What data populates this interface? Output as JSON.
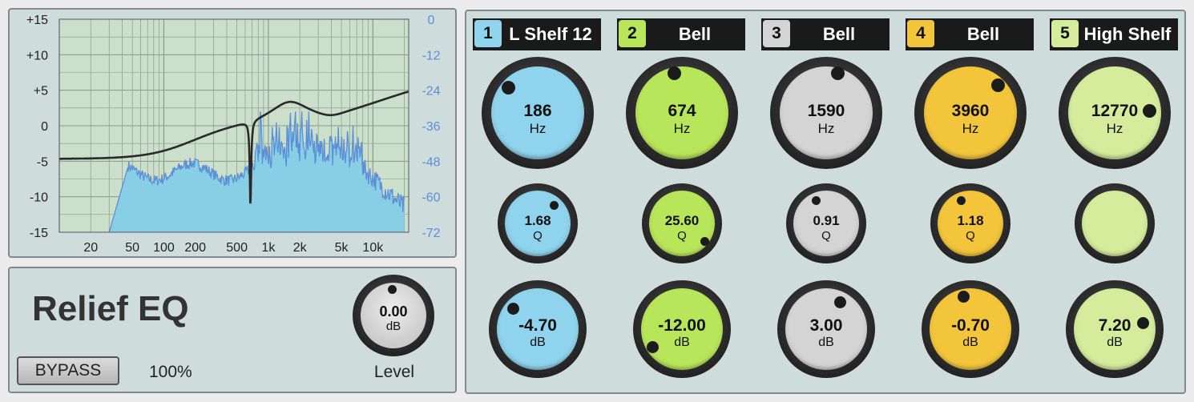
{
  "graph": {
    "left_axis_labels": [
      "+15",
      "+10",
      "+5",
      "0",
      "-5",
      "-10",
      "-15"
    ],
    "right_axis_labels": [
      "0",
      "-12",
      "-24",
      "-36",
      "-48",
      "-60",
      "-72"
    ],
    "freq_labels": [
      "20",
      "50",
      "100",
      "200",
      "500",
      "1k",
      "2k",
      "5k",
      "10k"
    ],
    "colors": {
      "background": "#cbdfcb",
      "spectrum_fill": "#88cfe6",
      "spectrum_line": "#5b8fd8",
      "curve": "#2a2a2a",
      "right_axis_text": "#5b8fd8"
    }
  },
  "info": {
    "title": "Relief EQ",
    "bypass_label": "BYPASS",
    "mix_percent": "100%",
    "level_value": "0.00",
    "level_unit": "dB",
    "level_label": "Level"
  },
  "bands": [
    {
      "number": "1",
      "type": "L Shelf 12",
      "color": "#8fd3ec",
      "freq": "186",
      "freq_unit": "Hz",
      "q": "1.68",
      "q_unit": "Q",
      "gain": "-4.70",
      "gain_unit": "dB"
    },
    {
      "number": "2",
      "type": "Bell",
      "color": "#b8e65a",
      "freq": "674",
      "freq_unit": "Hz",
      "q": "25.60",
      "q_unit": "Q",
      "gain": "-12.00",
      "gain_unit": "dB"
    },
    {
      "number": "3",
      "type": "Bell",
      "color": "#d4d4d4",
      "freq": "1590",
      "freq_unit": "Hz",
      "q": "0.91",
      "q_unit": "Q",
      "gain": "3.00",
      "gain_unit": "dB"
    },
    {
      "number": "4",
      "type": "Bell",
      "color": "#f3c53b",
      "freq": "3960",
      "freq_unit": "Hz",
      "q": "1.18",
      "q_unit": "Q",
      "gain": "-0.70",
      "gain_unit": "dB"
    },
    {
      "number": "5",
      "type": "High Shelf",
      "color": "#d4ec9c",
      "freq": "12770",
      "freq_unit": "Hz",
      "q": "",
      "q_unit": "",
      "gain": "7.20",
      "gain_unit": "dB"
    }
  ]
}
